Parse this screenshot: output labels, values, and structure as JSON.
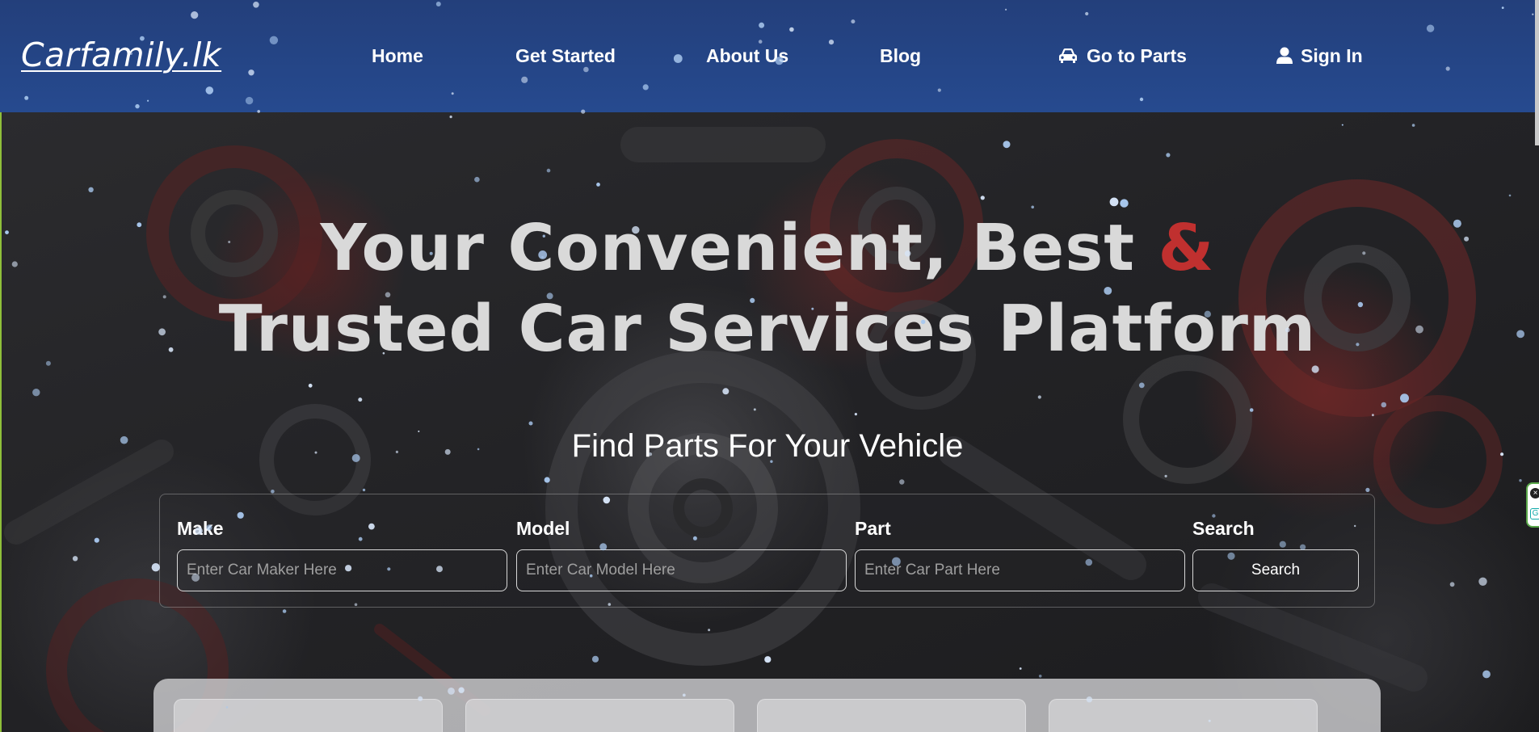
{
  "header": {
    "logo": "Carfamily.lk",
    "nav": [
      {
        "label": "Home",
        "icon": null
      },
      {
        "label": "Get Started",
        "icon": null
      },
      {
        "label": "About Us",
        "icon": null
      },
      {
        "label": "Blog",
        "icon": null
      },
      {
        "label": "Go to Parts",
        "icon": "car-icon"
      },
      {
        "label": "Sign In",
        "icon": "user-icon"
      }
    ]
  },
  "hero": {
    "headline_line1": "Your Convenient, Best",
    "headline_amp": "&",
    "headline_line2": "Trusted Car Services Platform",
    "subheading": "Find Parts For Your Vehicle"
  },
  "search": {
    "make_label": "Make",
    "make_placeholder": "Enter Car Maker Here",
    "model_label": "Model",
    "model_placeholder": "Enter Car Model Here",
    "part_label": "Part",
    "part_placeholder": "Enter Car Part Here",
    "search_label": "Search",
    "button_label": "Search"
  },
  "colors": {
    "header_blue": "#264a8f",
    "accent_red": "#c0302f",
    "text_white": "#ffffff"
  }
}
